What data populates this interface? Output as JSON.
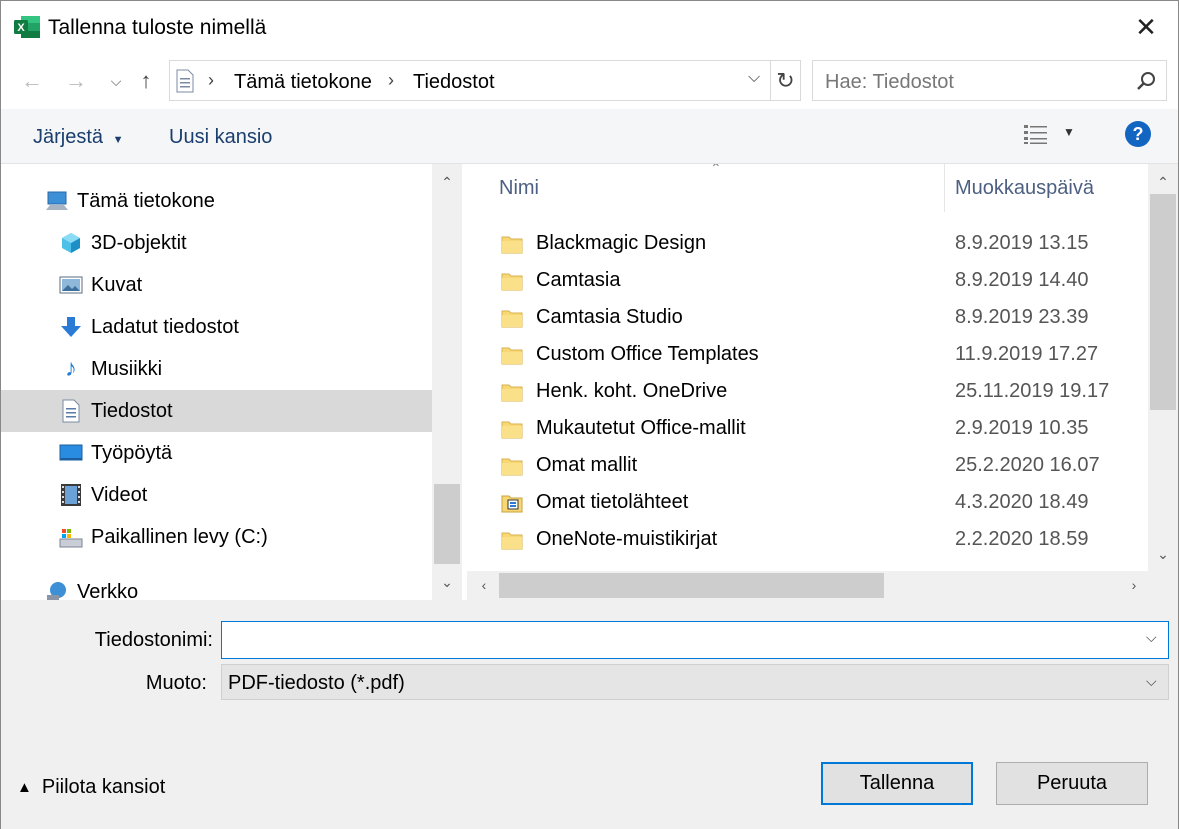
{
  "window": {
    "title": "Tallenna tuloste nimellä",
    "app_icon": "excel-icon",
    "close_label": "✕"
  },
  "address": {
    "crumbs": [
      "Tämä tietokone",
      "Tiedostot"
    ],
    "search_placeholder": "Hae: Tiedostot"
  },
  "toolbar": {
    "organize_label": "Järjestä",
    "new_folder_label": "Uusi kansio",
    "help_label": "?"
  },
  "nav_pane": {
    "items": [
      {
        "label": "Tämä tietokone",
        "icon": "computer-icon",
        "selected": false
      },
      {
        "label": "3D-objektit",
        "icon": "cube-3d-icon",
        "selected": false
      },
      {
        "label": "Kuvat",
        "icon": "pictures-icon",
        "selected": false
      },
      {
        "label": "Ladatut tiedostot",
        "icon": "download-icon",
        "selected": false
      },
      {
        "label": "Musiikki",
        "icon": "music-icon",
        "selected": false
      },
      {
        "label": "Tiedostot",
        "icon": "documents-icon",
        "selected": true
      },
      {
        "label": "Työpöytä",
        "icon": "desktop-icon",
        "selected": false
      },
      {
        "label": "Videot",
        "icon": "videos-icon",
        "selected": false
      },
      {
        "label": "Paikallinen levy (C:)",
        "icon": "drive-icon",
        "selected": false
      },
      {
        "label": "Verkko",
        "icon": "network-icon",
        "selected": false
      }
    ]
  },
  "file_list": {
    "columns": [
      "Nimi",
      "Muokkauspäivä"
    ],
    "rows": [
      {
        "name": "Blackmagic Design",
        "date": "8.9.2019 13.15",
        "icon": "folder-icon"
      },
      {
        "name": "Camtasia",
        "date": "8.9.2019 14.40",
        "icon": "folder-icon"
      },
      {
        "name": "Camtasia Studio",
        "date": "8.9.2019 23.39",
        "icon": "folder-icon"
      },
      {
        "name": "Custom Office Templates",
        "date": "11.9.2019 17.27",
        "icon": "folder-icon"
      },
      {
        "name": "Henk. koht. OneDrive",
        "date": "25.11.2019 19.17",
        "icon": "folder-icon"
      },
      {
        "name": "Mukautetut Office-mallit",
        "date": "2.9.2019 10.35",
        "icon": "folder-icon"
      },
      {
        "name": "Omat mallit",
        "date": "25.2.2020 16.07",
        "icon": "folder-icon"
      },
      {
        "name": "Omat tietolähteet",
        "date": "4.3.2020 18.49",
        "icon": "data-sources-folder-icon"
      },
      {
        "name": "OneNote-muistikirjat",
        "date": "2.2.2020 18.59",
        "icon": "folder-icon"
      }
    ]
  },
  "form": {
    "filename_label": "Tiedostonimi:",
    "filename_value": "",
    "type_label": "Muoto:",
    "type_value": "PDF-tiedosto (*.pdf)"
  },
  "footer": {
    "hide_folders_label": "Piilota kansiot",
    "save_label": "Tallenna",
    "cancel_label": "Peruuta"
  },
  "colors": {
    "accent": "#0078d7",
    "folder": "#f8d775",
    "selected_bg": "#d9d9d9"
  }
}
